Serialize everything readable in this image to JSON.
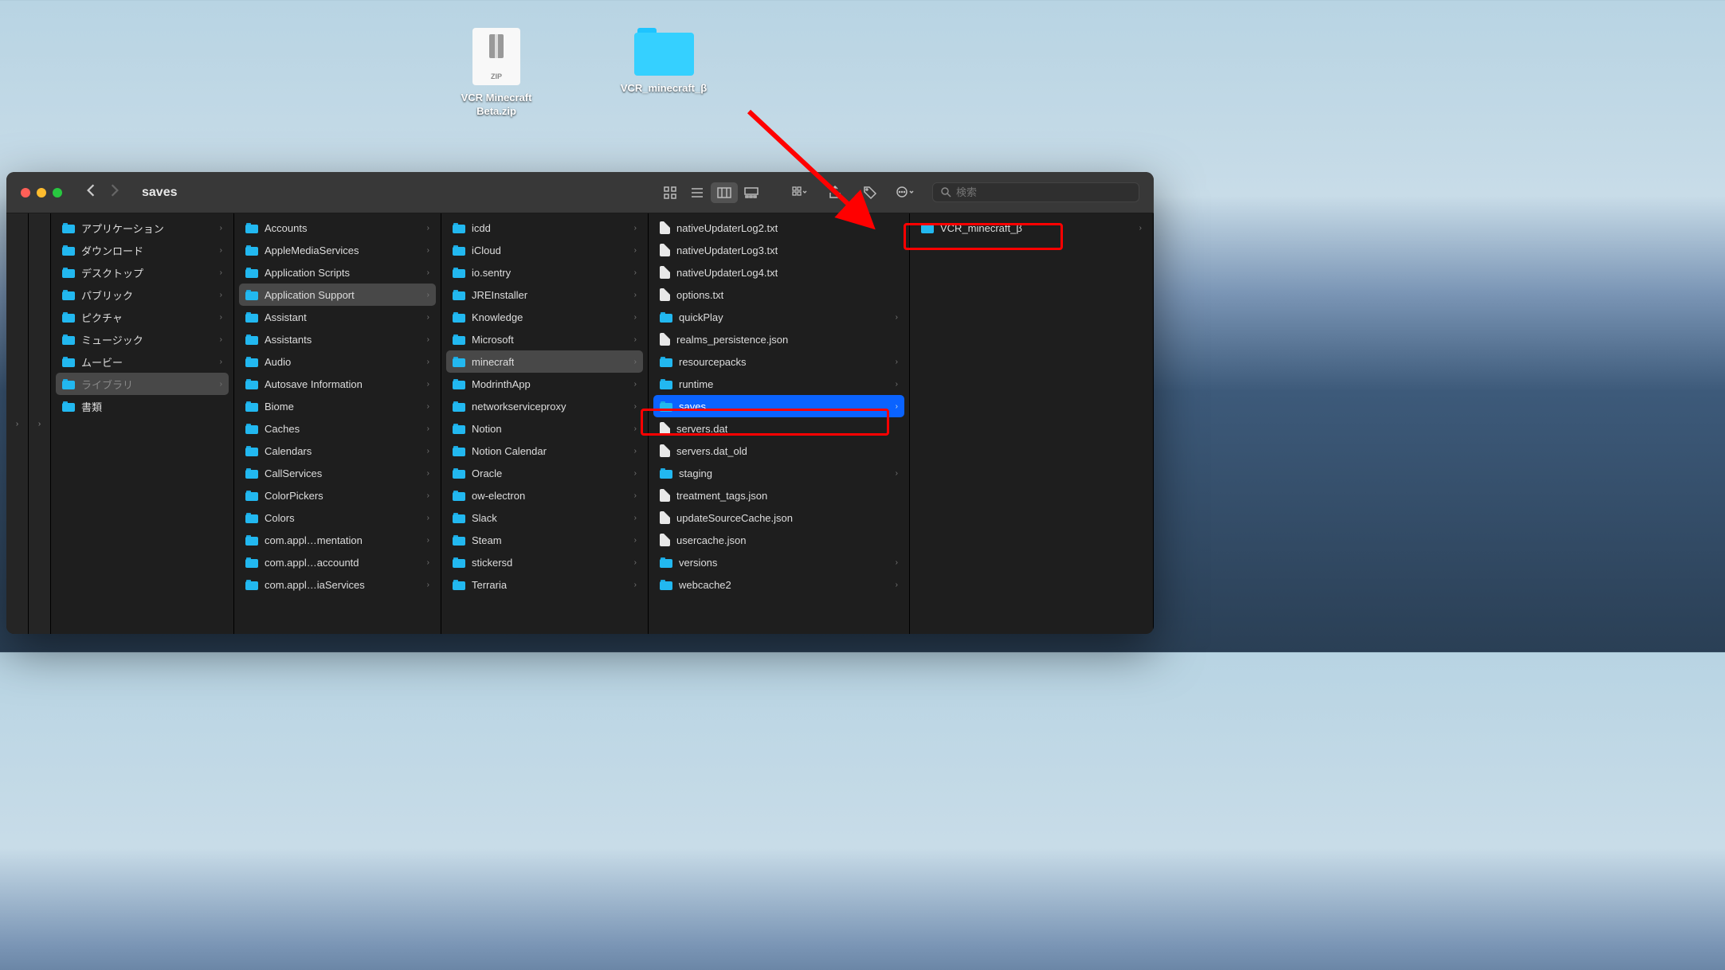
{
  "desktop": {
    "zip": {
      "name": "VCR Minecraft Beta.zip",
      "badge": "ZIP"
    },
    "folder": {
      "name": "VCR_minecraft_β"
    }
  },
  "window": {
    "title": "saves",
    "search_placeholder": "検索"
  },
  "col1": [
    {
      "label": "アプリケーション",
      "type": "folder",
      "arrow": true
    },
    {
      "label": "ダウンロード",
      "type": "folder",
      "arrow": true
    },
    {
      "label": "デスクトップ",
      "type": "folder",
      "arrow": true
    },
    {
      "label": "パブリック",
      "type": "folder",
      "arrow": true
    },
    {
      "label": "ピクチャ",
      "type": "folder",
      "arrow": true
    },
    {
      "label": "ミュージック",
      "type": "folder",
      "arrow": true
    },
    {
      "label": "ムービー",
      "type": "folder",
      "arrow": true
    },
    {
      "label": "ライブラリ",
      "type": "folder",
      "arrow": true,
      "selected": "path",
      "dim": true
    },
    {
      "label": "書類",
      "type": "folder"
    }
  ],
  "col2": [
    {
      "label": "Accounts",
      "type": "folder",
      "arrow": true
    },
    {
      "label": "AppleMediaServices",
      "type": "folder",
      "arrow": true
    },
    {
      "label": "Application Scripts",
      "type": "folder",
      "arrow": true
    },
    {
      "label": "Application Support",
      "type": "folder",
      "arrow": true,
      "selected": "path"
    },
    {
      "label": "Assistant",
      "type": "folder",
      "arrow": true
    },
    {
      "label": "Assistants",
      "type": "folder",
      "arrow": true
    },
    {
      "label": "Audio",
      "type": "folder",
      "arrow": true
    },
    {
      "label": "Autosave Information",
      "type": "folder",
      "arrow": true
    },
    {
      "label": "Biome",
      "type": "folder",
      "arrow": true
    },
    {
      "label": "Caches",
      "type": "folder",
      "arrow": true
    },
    {
      "label": "Calendars",
      "type": "folder",
      "arrow": true
    },
    {
      "label": "CallServices",
      "type": "folder",
      "arrow": true
    },
    {
      "label": "ColorPickers",
      "type": "folder",
      "arrow": true
    },
    {
      "label": "Colors",
      "type": "folder",
      "arrow": true
    },
    {
      "label": "com.appl…mentation",
      "type": "folder",
      "arrow": true
    },
    {
      "label": "com.appl…accountd",
      "type": "folder",
      "arrow": true
    },
    {
      "label": "com.appl…iaServices",
      "type": "folder",
      "arrow": true
    }
  ],
  "col3": [
    {
      "label": "icdd",
      "type": "folder",
      "arrow": true
    },
    {
      "label": "iCloud",
      "type": "folder",
      "arrow": true
    },
    {
      "label": "io.sentry",
      "type": "folder",
      "arrow": true
    },
    {
      "label": "JREInstaller",
      "type": "folder",
      "arrow": true
    },
    {
      "label": "Knowledge",
      "type": "folder",
      "arrow": true
    },
    {
      "label": "Microsoft",
      "type": "folder",
      "arrow": true
    },
    {
      "label": "minecraft",
      "type": "folder",
      "arrow": true,
      "selected": "path"
    },
    {
      "label": "ModrinthApp",
      "type": "folder",
      "arrow": true
    },
    {
      "label": "networkserviceproxy",
      "type": "folder",
      "arrow": true
    },
    {
      "label": "Notion",
      "type": "folder",
      "arrow": true
    },
    {
      "label": "Notion Calendar",
      "type": "folder",
      "arrow": true
    },
    {
      "label": "Oracle",
      "type": "folder",
      "arrow": true
    },
    {
      "label": "ow-electron",
      "type": "folder",
      "arrow": true
    },
    {
      "label": "Slack",
      "type": "folder",
      "arrow": true
    },
    {
      "label": "Steam",
      "type": "folder",
      "arrow": true
    },
    {
      "label": "stickersd",
      "type": "folder",
      "arrow": true
    },
    {
      "label": "Terraria",
      "type": "folder",
      "arrow": true
    }
  ],
  "col4": [
    {
      "label": "nativeUpdaterLog2.txt",
      "type": "file"
    },
    {
      "label": "nativeUpdaterLog3.txt",
      "type": "file"
    },
    {
      "label": "nativeUpdaterLog4.txt",
      "type": "file"
    },
    {
      "label": "options.txt",
      "type": "file"
    },
    {
      "label": "quickPlay",
      "type": "folder",
      "arrow": true
    },
    {
      "label": "realms_persistence.json",
      "type": "file"
    },
    {
      "label": "resourcepacks",
      "type": "folder",
      "arrow": true
    },
    {
      "label": "runtime",
      "type": "folder",
      "arrow": true
    },
    {
      "label": "saves",
      "type": "folder",
      "arrow": true,
      "selected": "sel"
    },
    {
      "label": "servers.dat",
      "type": "file"
    },
    {
      "label": "servers.dat_old",
      "type": "file"
    },
    {
      "label": "staging",
      "type": "folder",
      "arrow": true
    },
    {
      "label": "treatment_tags.json",
      "type": "file"
    },
    {
      "label": "updateSourceCache.json",
      "type": "file"
    },
    {
      "label": "usercache.json",
      "type": "file"
    },
    {
      "label": "versions",
      "type": "folder",
      "arrow": true
    },
    {
      "label": "webcache2",
      "type": "folder",
      "arrow": true
    }
  ],
  "col5": [
    {
      "label": "VCR_minecraft_β",
      "type": "folder",
      "arrow": true
    }
  ]
}
